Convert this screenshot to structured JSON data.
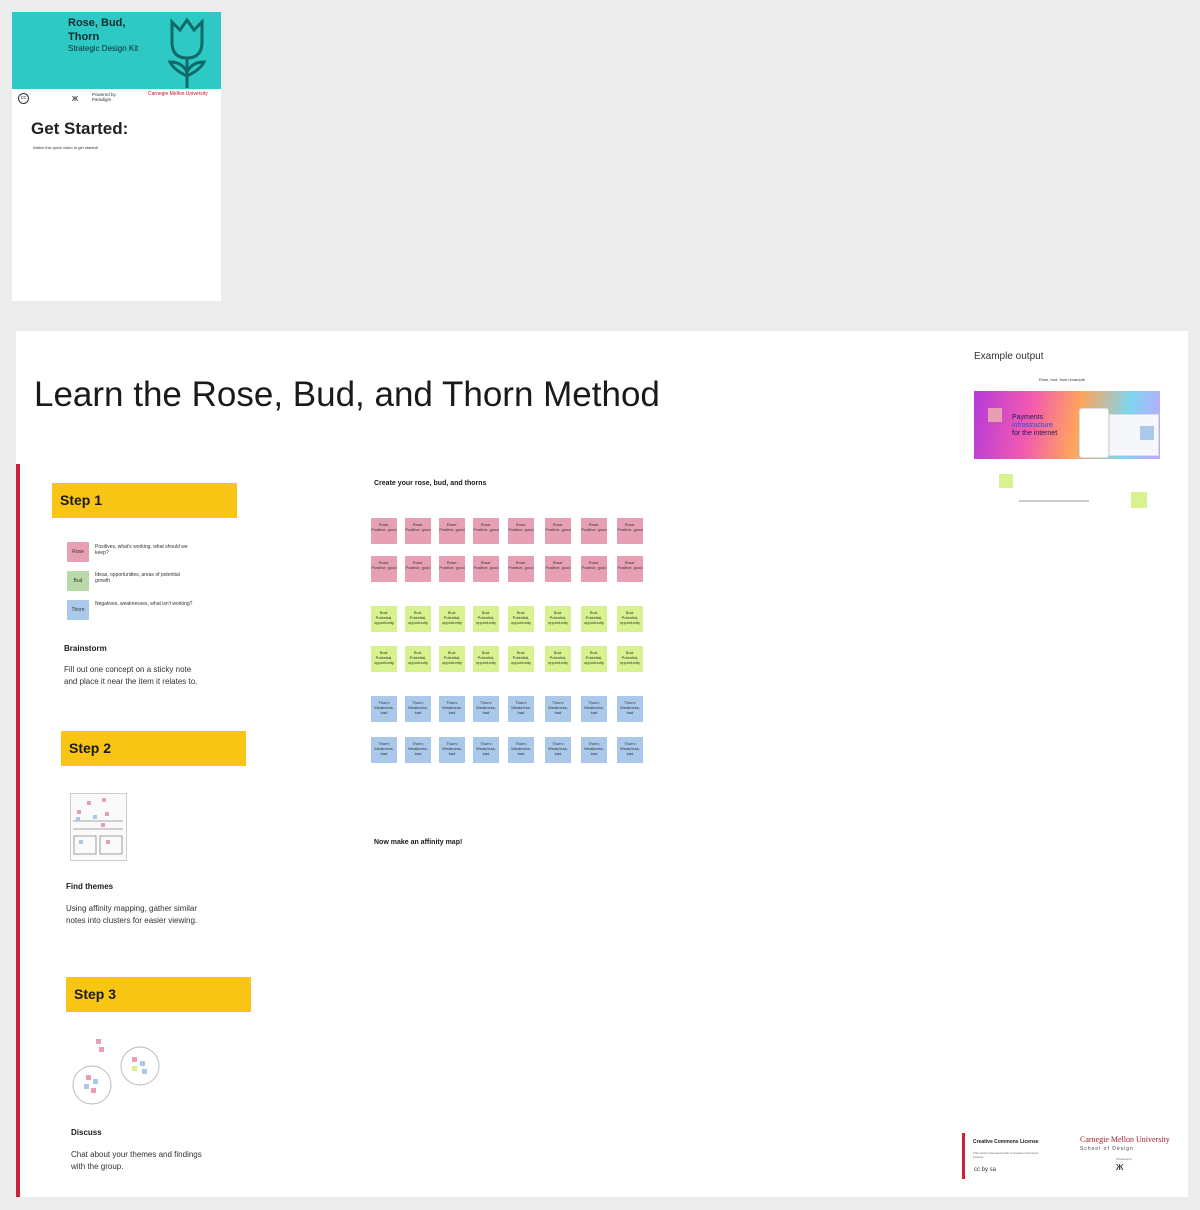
{
  "kit_card": {
    "title_line1": "Rose, Bud,",
    "title_line2": "Thorn",
    "subtitle": "Strategic Design Kit",
    "cc_label": "cc",
    "powered_by": "Powered by Paradigm",
    "cmu_small": "Carnegie Mellon University",
    "get_started": "Get Started:",
    "get_started_sub": "Watch this quick video to get started!"
  },
  "board": {
    "title": "Learn the Rose, Bud, and Thorn Method",
    "example_label": "Example output",
    "example": {
      "heading": "Rose, bud, thorn example",
      "headline_1": "Payments",
      "headline_2": "infrastructure",
      "headline_3": "for the internet"
    },
    "step1": {
      "label": "Step 1",
      "legend": [
        {
          "swatch": "Rose",
          "text": "Positives, what's working, what should we keep?"
        },
        {
          "swatch": "Bud",
          "text": "Ideas, opportunities, areas of potential growth"
        },
        {
          "swatch": "Thorn",
          "text": "Negatives, weaknesses, what isn't working?"
        }
      ],
      "heading": "Brainstorm",
      "body": "Fill out one concept on a sticky note and place it near the item it relates to."
    },
    "step2": {
      "label": "Step 2",
      "heading": "Find themes",
      "body": "Using affinity mapping, gather similar notes into clusters for easier viewing."
    },
    "step3": {
      "label": "Step 3",
      "heading": "Discuss",
      "body": "Chat about your themes and findings with the group."
    },
    "create_label": "Create your rose, bud, and thorns",
    "affinity_label": "Now make an affinity map!",
    "stickies": {
      "rose": "Rose: Positive, good",
      "bud": "Bud: Potential, opportunity",
      "thorn": "Thorn: Weakness, bad"
    },
    "footer": {
      "cc_heading": "Creative Commons License",
      "cc_text": "This work is licensed under a Creative Commons License.",
      "cc_badges": "cc by sa",
      "cmu": "Carnegie Mellon University",
      "cmu_sub": "School of Design",
      "powered": "Powered by"
    }
  },
  "colors": {
    "rose": "#e7a0b3",
    "bud": "#d7f28f",
    "thorn": "#a9c8ea",
    "step_banner": "#f8c514",
    "accent_red": "#c8233a",
    "kit_teal": "#2ec9c5"
  }
}
